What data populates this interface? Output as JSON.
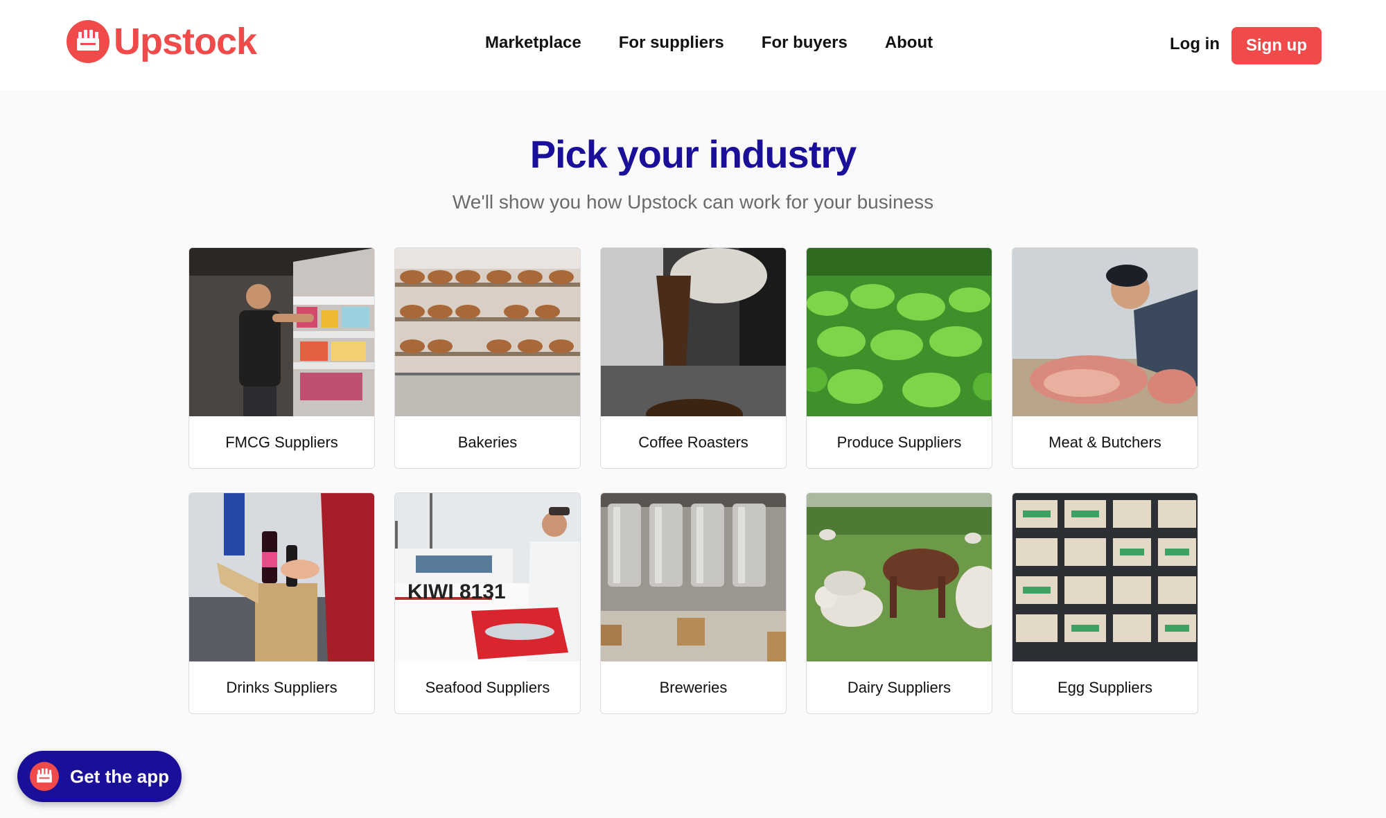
{
  "brand": {
    "name": "Upstock",
    "color": "#f04a4a"
  },
  "nav": {
    "items": [
      {
        "label": "Marketplace"
      },
      {
        "label": "For suppliers"
      },
      {
        "label": "For buyers"
      },
      {
        "label": "About"
      }
    ],
    "login_label": "Log in",
    "signup_label": "Sign up"
  },
  "hero": {
    "title": "Pick your industry",
    "subtitle": "We'll show you how Upstock can work for your business",
    "title_color": "#1a0f99"
  },
  "industries": [
    {
      "label": "FMCG Suppliers",
      "image": "supermarket-aisle-photo"
    },
    {
      "label": "Bakeries",
      "image": "bread-shelves-photo"
    },
    {
      "label": "Coffee Roasters",
      "image": "coffee-beans-pouring-photo"
    },
    {
      "label": "Produce Suppliers",
      "image": "lettuce-field-photo"
    },
    {
      "label": "Meat & Butchers",
      "image": "butcher-cutting-meat-photo"
    },
    {
      "label": "Drinks Suppliers",
      "image": "bottle-packing-photo"
    },
    {
      "label": "Seafood Suppliers",
      "image": "fisherman-boat-photo"
    },
    {
      "label": "Breweries",
      "image": "brewery-tanks-photo"
    },
    {
      "label": "Dairy Suppliers",
      "image": "cow-and-sheep-photo"
    },
    {
      "label": "Egg Suppliers",
      "image": "egg-cartons-photo"
    }
  ],
  "app_cta": {
    "label": "Get the app",
    "color": "#1a0f99"
  }
}
